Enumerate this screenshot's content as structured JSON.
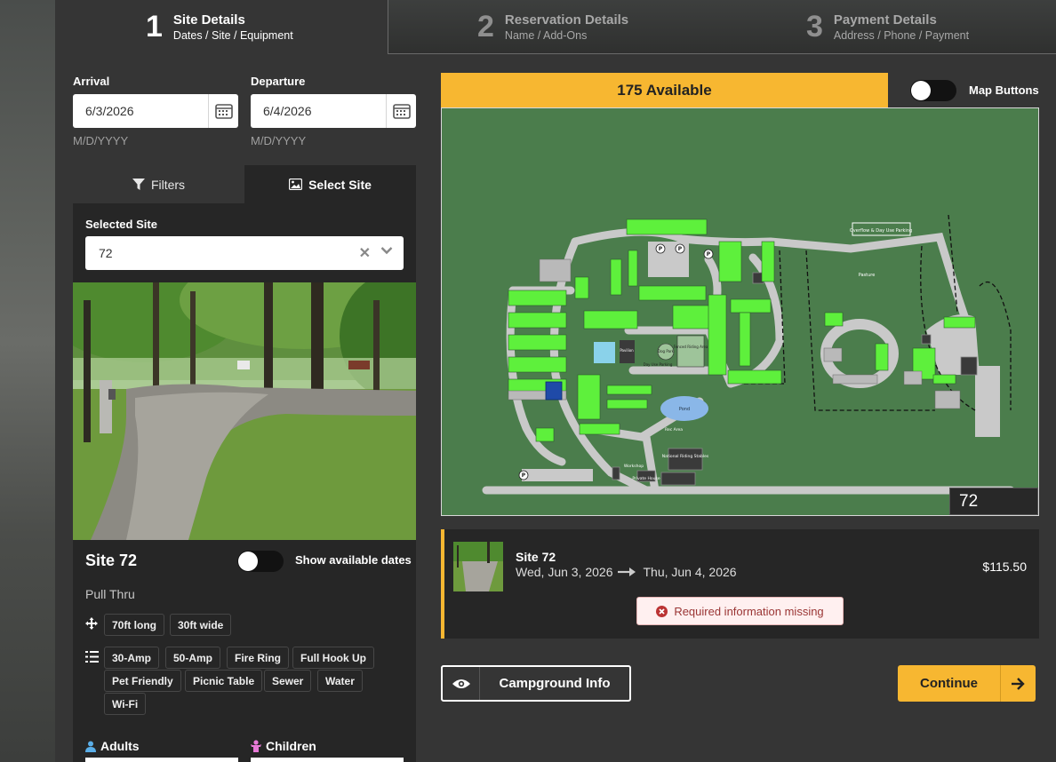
{
  "steps": [
    {
      "num": "1",
      "title": "Site Details",
      "sub": "Dates / Site / Equipment"
    },
    {
      "num": "2",
      "title": "Reservation Details",
      "sub": "Name / Add-Ons"
    },
    {
      "num": "3",
      "title": "Payment Details",
      "sub": "Address / Phone / Payment"
    }
  ],
  "dates": {
    "arrival_label": "Arrival",
    "arrival_value": "6/3/2026",
    "departure_label": "Departure",
    "departure_value": "6/4/2026",
    "format_hint": "M/D/YYYY"
  },
  "tabs": {
    "filters": "Filters",
    "select_site": "Select Site"
  },
  "site": {
    "selected_label": "Selected Site",
    "selected_value": "72",
    "name": "Site 72",
    "show_dates_label": "Show available dates",
    "type": "Pull Thru",
    "dimensions": [
      "70ft long",
      "30ft wide"
    ],
    "amenities": [
      "30-Amp",
      "50-Amp",
      "Fire Ring",
      "Full Hook Up",
      "Pet Friendly",
      "Picnic Table",
      "Sewer",
      "Water",
      "Wi-Fi"
    ]
  },
  "people": {
    "adults": "Adults",
    "children": "Children"
  },
  "availability": "175 Available",
  "map_buttons_label": "Map Buttons",
  "map": {
    "selected_site": "72",
    "labels": {
      "overflow": "Overflow & Day Use Parking",
      "pasture": "Pasture",
      "pond": "Pond",
      "pavilion": "Pavilion",
      "dog_park": "Dog Park",
      "fenced_riding": "Fenced Riding Area",
      "day_use": "Day Use Parking",
      "rec_area": "Rec Area",
      "stables": "National Riding Stables",
      "workshop": "Workshop",
      "private_house": "Private House",
      "parking": "P"
    }
  },
  "cart": {
    "site": "Site 72",
    "from": "Wed, Jun 3, 2026",
    "to": "Thu, Jun 4, 2026",
    "price": "$115.50",
    "warning": "Required information missing"
  },
  "buttons": {
    "campground_info": "Campground Info",
    "continue": "Continue"
  },
  "colors": {
    "accent": "#f7b731",
    "available_site": "#5ef03c",
    "selected_site": "#1f4aa8",
    "map_bg": "#4b7d4c"
  }
}
